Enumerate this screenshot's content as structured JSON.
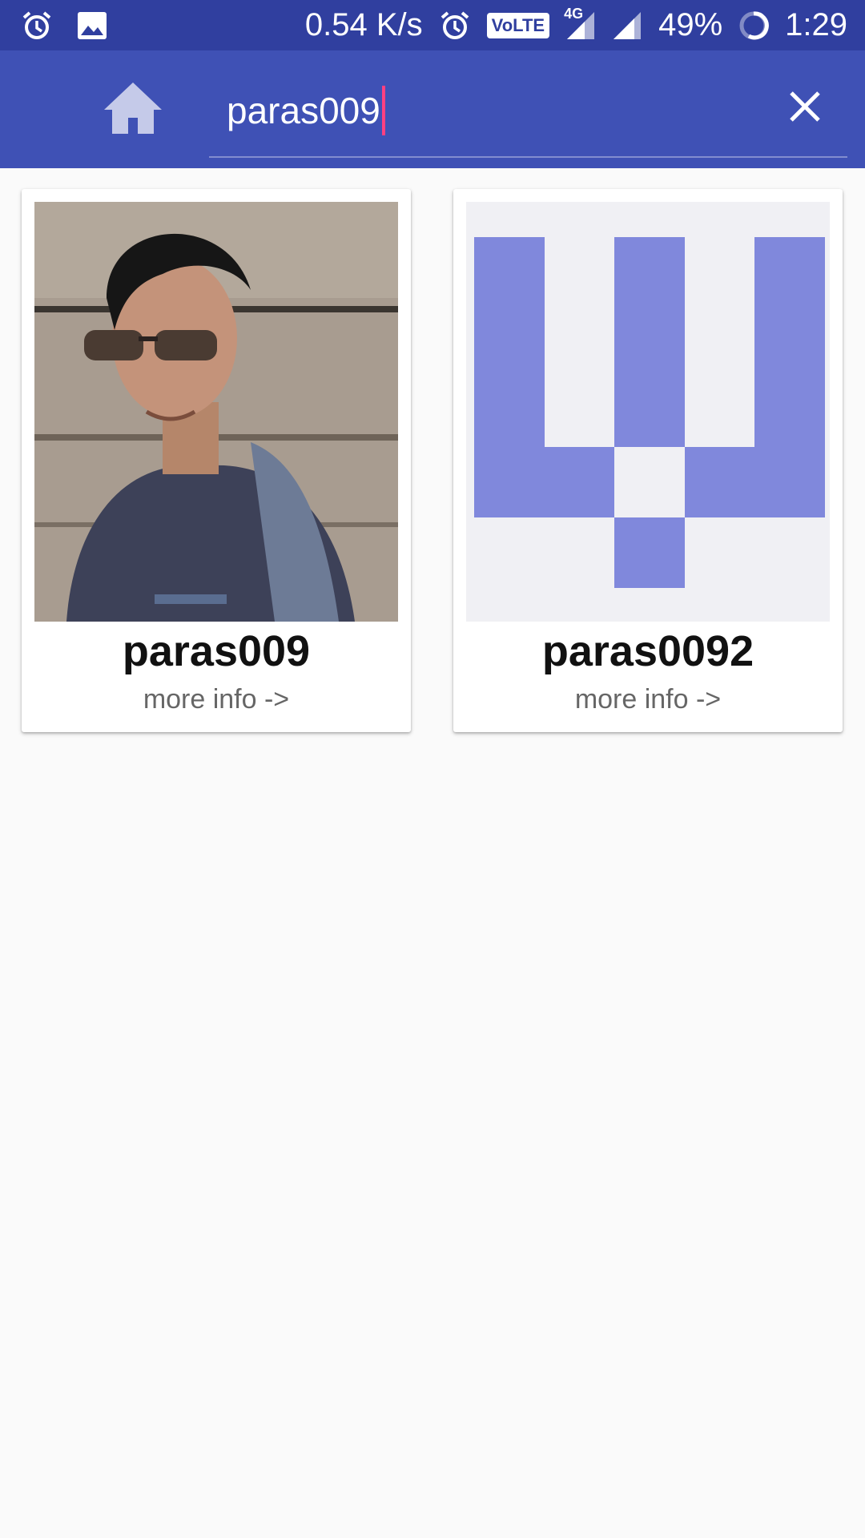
{
  "status_bar": {
    "net_speed": "0.54 K/s",
    "network_type": "4G",
    "volte_label": "VoLTE",
    "battery_percent": "49%",
    "time": "1:29"
  },
  "app_bar": {
    "search": {
      "value": "paras009"
    }
  },
  "results": [
    {
      "username": "paras009",
      "link_label": "more info ->",
      "avatar": "photo"
    },
    {
      "username": "paras0092",
      "link_label": "more info ->",
      "avatar": "identicon"
    }
  ],
  "colors": {
    "status_bar": "#303f9f",
    "app_bar": "#3f51b5",
    "identicon": "#8088dc",
    "caret": "#ff4081"
  }
}
